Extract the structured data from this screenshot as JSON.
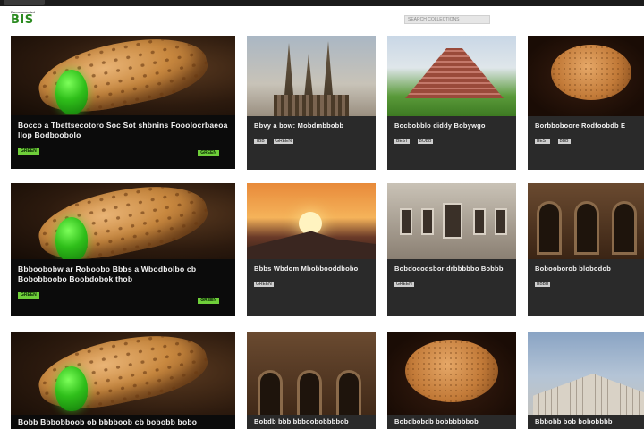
{
  "header": {
    "tag": "Recommended",
    "logo": "BIS",
    "search_placeholder": "SEARCH COLLECTIONS"
  },
  "cards": [
    {
      "title": "Bocco a Tbettsecotoro Soc Sot shbnins Fooolocrbaeoa llop Bodboobolo",
      "badge": "GREEN",
      "badge_right": "GREEN"
    },
    {
      "title": "Bbvy a bow: Mobdmbbobb",
      "badges": [
        "TBB",
        "GREEN"
      ]
    },
    {
      "title": "Bocbobblo diddy Bobywgo",
      "badges": [
        "BEST",
        "BOBB"
      ]
    },
    {
      "title": "Borbboboore Rodfoobdb E",
      "badges": [
        "BEST",
        "BBB"
      ]
    },
    {
      "title": "Bbboobobw ar Roboobo Bbbs a Wbodbolbo cb Bobobboobo Boobdobok thob",
      "badge": "GREEN",
      "badge_right": "GREEN"
    },
    {
      "title": "Bbbs Wbdom Mbobbooddbobo",
      "badges": [
        "GREEN"
      ]
    },
    {
      "title": "Bobdocodsbor drbbbbbo Bobbb",
      "badges": [
        "GREEN"
      ]
    },
    {
      "title": "Bobooborob blobodob",
      "badges": [
        "BBBB"
      ]
    },
    {
      "title": "Bobb Bbbobboob ob bbbboob cb bobobb bobo",
      "badge": "",
      "badge_right": ""
    },
    {
      "title": "Bobdb bbb bbboobobbbbob",
      "badges": []
    },
    {
      "title": "Bobdbobdb bobbbbbbob",
      "badges": []
    },
    {
      "title": "Bbbobb bob bobobbbb",
      "badges": []
    }
  ]
}
